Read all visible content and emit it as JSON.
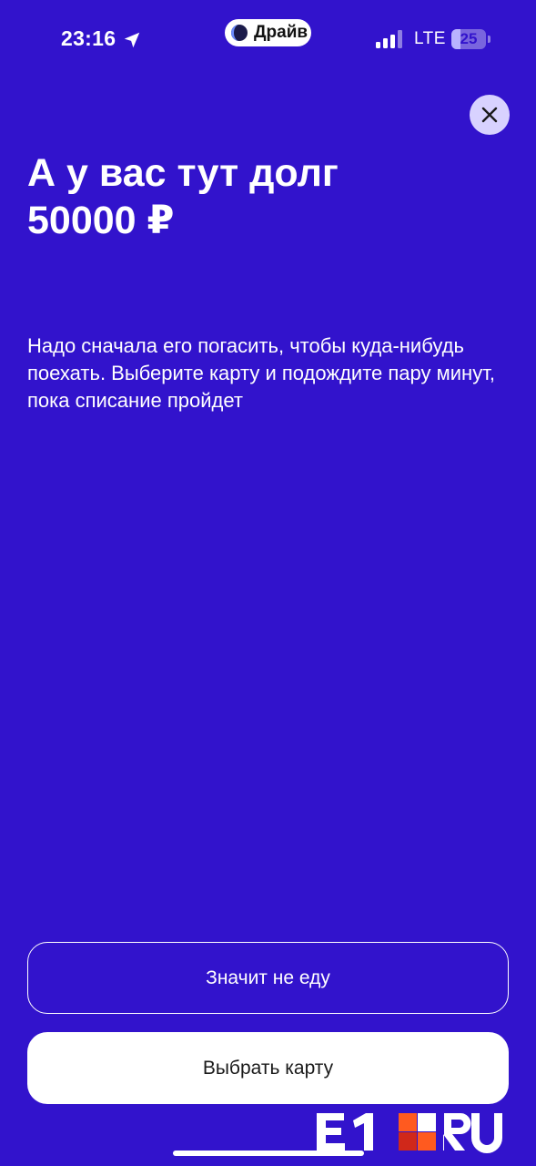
{
  "status_bar": {
    "time": "23:16",
    "app_name": "Драйв",
    "network": "LTE",
    "battery_percent": 25,
    "battery_label": "25",
    "icons": [
      "location-arrow-icon",
      "drive-moon-icon",
      "cellular-signal-icon",
      "battery-icon"
    ]
  },
  "dialog": {
    "title": "А у вас тут долг 50000 ₽",
    "description": "Надо сначала его погасить, чтобы куда-нибудь поехать. Выберите карту и подождите пару минут, пока списание пройдет",
    "close_icon": "close-icon"
  },
  "actions": {
    "decline_label": "Значит не еду",
    "choose_card_label": "Выбрать карту"
  },
  "watermark": {
    "logo_text": "E1RU",
    "colors": {
      "orange": "#ff5a1f",
      "red": "#d0281a"
    }
  },
  "colors": {
    "background": "#3213cc",
    "close_button": "#d8d2ff",
    "text": "#ffffff"
  }
}
